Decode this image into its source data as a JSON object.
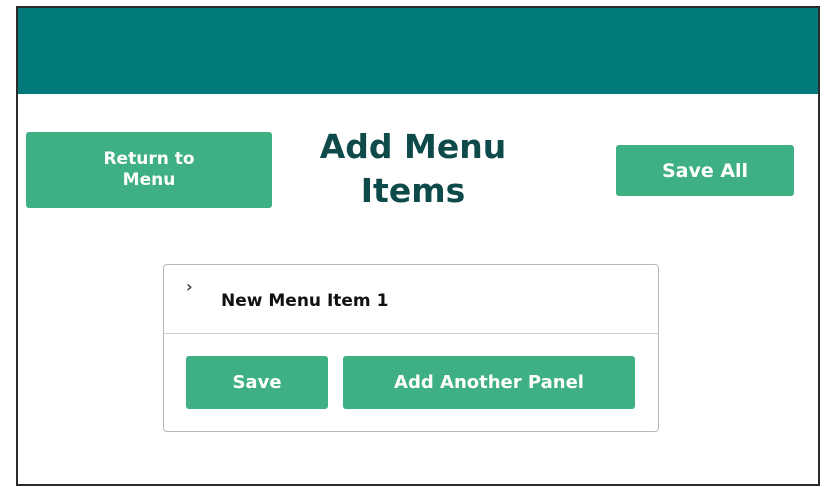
{
  "header": {
    "bar_color": "#007a7a"
  },
  "toolbar": {
    "return_label": "Return to Menu",
    "title": "Add Menu Items",
    "save_all_label": "Save All"
  },
  "panel": {
    "expand_icon": "chevron-right-icon",
    "item_title": "New Menu Item 1",
    "save_label": "Save",
    "add_panel_label": "Add Another Panel"
  },
  "colors": {
    "button": "#3fb083",
    "title": "#0e4a4a"
  }
}
